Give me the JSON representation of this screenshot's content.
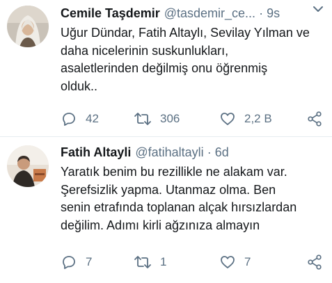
{
  "tweets": [
    {
      "name": "Cemile Taşdemir",
      "handle": "@tasdemir_ce...",
      "separator": "·",
      "time": "9s",
      "text": "Uğur Dündar, Fatih Altaylı, Sevilay Yılman ve\ndaha nicelerinin suskunlukları,\nasaletlerinden değilmiş onu öğrenmiş\nolduk..",
      "replies": "42",
      "retweets": "306",
      "likes": "2,2 B",
      "icons": [
        "reply-icon",
        "retweet-icon",
        "like-icon",
        "share-icon",
        "chevron-down-icon"
      ]
    },
    {
      "name": "Fatih Altayli",
      "handle": "@fatihaltayli",
      "separator": "·",
      "time": "6d",
      "text": "Yaratık benim bu rezillikle ne alakam var.\nŞerefsizlik yapma. Utanmaz olma. Ben\nsenin etrafında toplanan alçak hırsızlardan\ndeğilim. Adımı kirli ağzınıza almayın",
      "replies": "7",
      "retweets": "1",
      "likes": "7",
      "icons": [
        "reply-icon",
        "retweet-icon",
        "like-icon",
        "share-icon"
      ]
    }
  ],
  "colors": {
    "text": "#14171a",
    "secondary": "#5b7083",
    "divider": "#e6ecf0"
  }
}
